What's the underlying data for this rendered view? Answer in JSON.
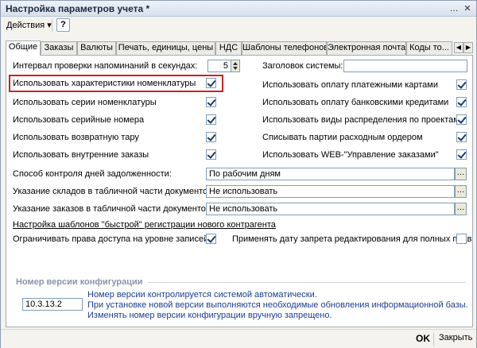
{
  "window": {
    "title": "Настройка параметров учета *",
    "menu_icon": "ellipsis-icon",
    "close_icon": "close-icon"
  },
  "toolbar": {
    "actions_label": "Действия ▾",
    "help_label": "?"
  },
  "tabs": [
    {
      "label": "Общие",
      "active": true
    },
    {
      "label": "Заказы"
    },
    {
      "label": "Валюты"
    },
    {
      "label": "Печать, единицы, цены"
    },
    {
      "label": "НДС"
    },
    {
      "label": "Шаблоны телефонов"
    },
    {
      "label": "Электронная почта"
    },
    {
      "label": "Коды то..."
    }
  ],
  "general": {
    "reminder_interval_label": "Интервал проверки напоминаний в секундах:",
    "reminder_interval_value": "5",
    "system_title_label": "Заголовок системы:",
    "system_title_value": "",
    "left_checks": [
      {
        "label": "Использовать характеристики номенклатуры",
        "checked": true
      },
      {
        "label": "Использовать серии номенклатуры",
        "checked": true
      },
      {
        "label": "Использовать серийные номера",
        "checked": true
      },
      {
        "label": "Использовать возвратную тару",
        "checked": true
      },
      {
        "label": "Использовать внутренние заказы",
        "checked": true
      }
    ],
    "right_checks": [
      {
        "label": "Использовать оплату платежными картами",
        "checked": true
      },
      {
        "label": "Использовать оплату банковскими кредитами",
        "checked": true
      },
      {
        "label": "Использовать виды распределения по проектам",
        "checked": true
      },
      {
        "label": "Списывать партии расходным ордером",
        "checked": true
      },
      {
        "label": "Использовать WEB-\"Управление заказами\"",
        "checked": true
      }
    ],
    "debt_control_label": "Способ контроля дней задолженности:",
    "debt_control_value": "По рабочим дням",
    "warehouses_label": "Указание складов в табличной части документов:",
    "warehouses_value": "Не использовать",
    "orders_label": "Указание заказов в табличной части документов:",
    "orders_value": "Не использовать",
    "quick_reg_link": "Настройка шаблонов \"быстрой\" регистрации нового контрагента",
    "restrict_access_label": "Ограничивать права доступа на уровне записей",
    "restrict_access_checked": true,
    "edit_ban_label": "Применять дату запрета редактирования для полных прав",
    "edit_ban_checked": false
  },
  "config_version": {
    "group_title": "Номер версии конфигурации",
    "value": "10.3.13.2",
    "info_lines": [
      "Номер версии контролируется системой автоматически.",
      "При установке новой версии выполняются необходимые обновления информационной базы.",
      "Изменять номер версии конфигурации вручную запрещено."
    ]
  },
  "footer": {
    "ok_label": "OK",
    "close_label": "Закрыть"
  },
  "colors": {
    "highlight": "#c92222",
    "info_text": "#1b3f8f",
    "group_title": "#8a95a8"
  }
}
